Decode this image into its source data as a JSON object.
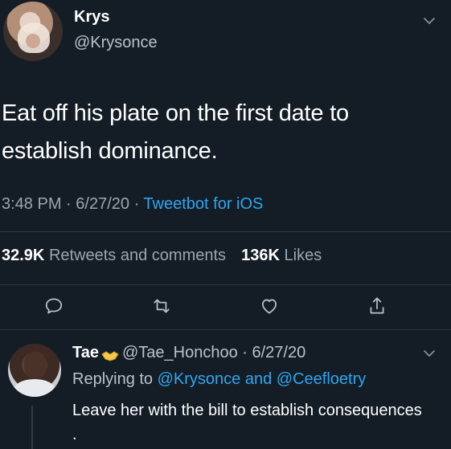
{
  "tweet": {
    "display_name": "Krys",
    "handle": "@Krysonce",
    "text": "Eat off his plate on the first date to establish dominance.",
    "time": "3:48 PM",
    "date": "6/27/20",
    "source": "Tweetbot for iOS",
    "retweets_count": "32.9K",
    "retweets_label": "Retweets and comments",
    "likes_count": "136K",
    "likes_label": "Likes"
  },
  "reply": {
    "display_name": "Tae",
    "handle": "@Tae_Honchoo",
    "date": "6/27/20",
    "replying_to_prefix": "Replying to",
    "mention_1": "@Krysonce",
    "conjunction": "and",
    "mention_2": "@Ceefloetry",
    "text": "Leave her with the bill to establish consequences ."
  },
  "colors": {
    "background": "#141d26",
    "link": "#2ea6f0",
    "muted": "#9aa6b2",
    "divider": "#2b3640"
  },
  "icons": {
    "reply": "speech-bubble-icon",
    "retweet": "retweet-icon",
    "like": "heart-icon",
    "share": "share-icon",
    "more": "chevron-down-icon",
    "reply_emoji": "handshake-emoji"
  }
}
